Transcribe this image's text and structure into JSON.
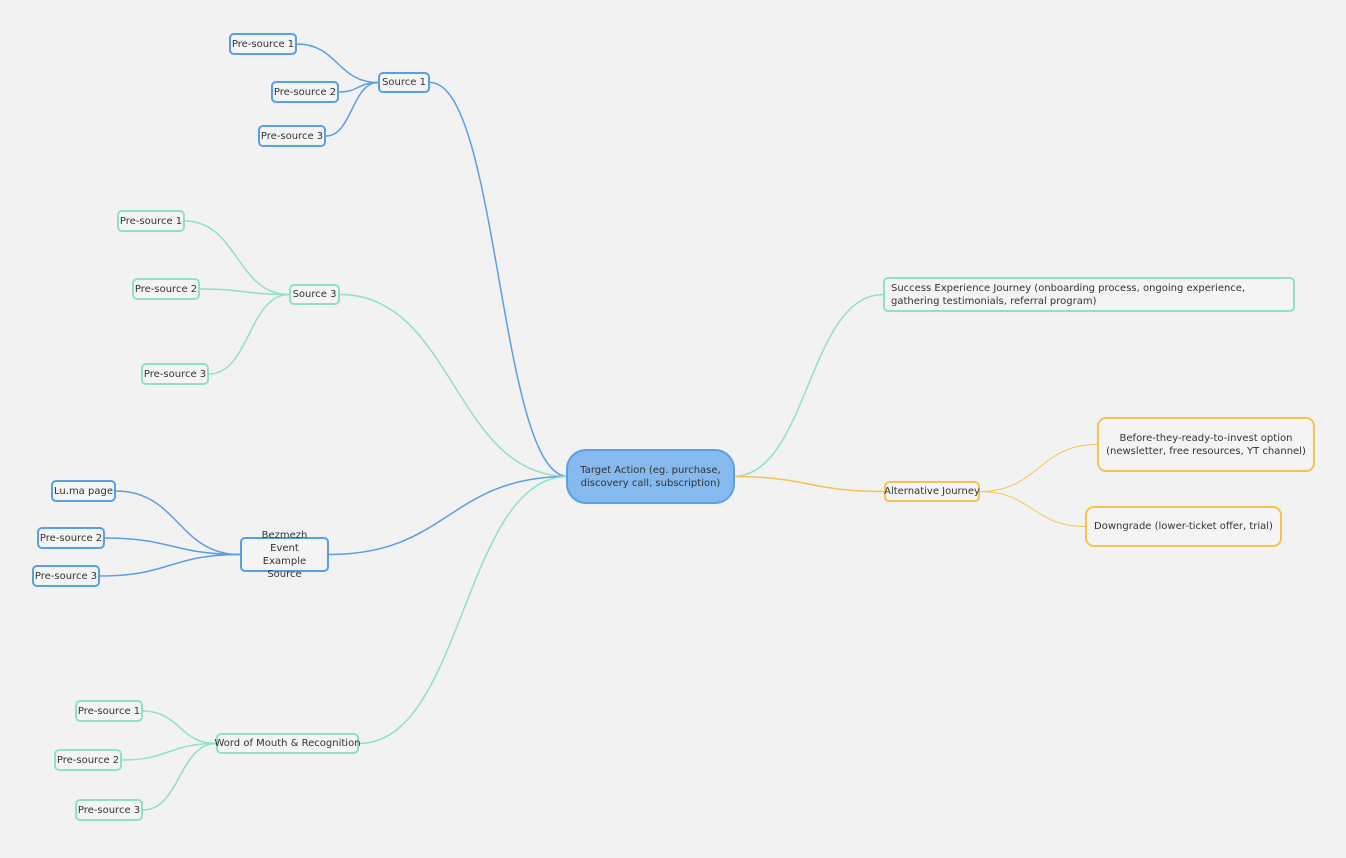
{
  "root": {
    "label": "Target Action (eg. purchase, discovery call, subscription)",
    "color": "#86b9ee"
  },
  "colors": {
    "blue": "#5a9fe3",
    "teal": "#8fe0c8",
    "yellow": "#f2c552",
    "background": "#f2f2f2"
  },
  "left_branches": [
    {
      "label": "Source 1",
      "color": "blue",
      "children": [
        "Pre-source 1",
        "Pre-source 2",
        "Pre-source 3"
      ]
    },
    {
      "label": "Source 3",
      "color": "teal",
      "children": [
        "Pre-source 1",
        "Pre-source 2",
        "Pre-source 3"
      ]
    },
    {
      "label": "Bezmezh Event Example Source",
      "color": "blue",
      "children": [
        "Lu.ma page",
        "Pre-source 2",
        "Pre-source 3"
      ]
    },
    {
      "label": "Word of Mouth & Recognition",
      "color": "teal",
      "children": [
        "Pre-source 1",
        "Pre-source 2",
        "Pre-source 3"
      ]
    }
  ],
  "right_branches": [
    {
      "label": "Success Experience Journey (onboarding process, ongoing experience, gathering testimonials, referral program)",
      "color": "teal",
      "children": []
    },
    {
      "label": "Alternative Journey",
      "color": "yellow",
      "children": [
        "Before-they-ready-to-invest option (newsletter, free resources, YT channel)",
        "Downgrade (lower-ticket offer, trial)"
      ]
    }
  ]
}
